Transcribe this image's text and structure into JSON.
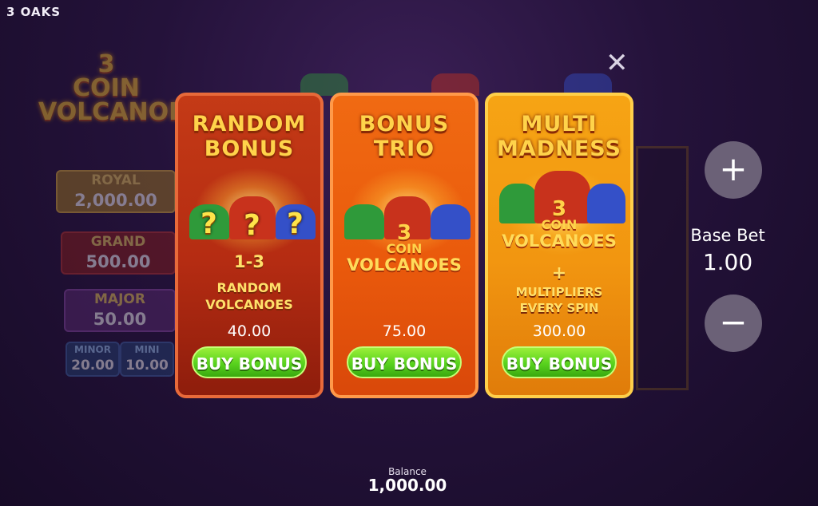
{
  "brand": "3 OAKS",
  "background": {
    "logo": {
      "line1": "3",
      "line2": "COIN",
      "line3": "VOLCANOES"
    },
    "jackpots": {
      "royal": {
        "label": "ROYAL",
        "value": "2,000.00"
      },
      "grand": {
        "label": "GRAND",
        "value": "500.00"
      },
      "major": {
        "label": "MAJOR",
        "value": "50.00"
      },
      "minor": {
        "label": "MINOR",
        "value": "20.00"
      },
      "mini": {
        "label": "MINI",
        "value": "10.00"
      }
    }
  },
  "close_symbol": "✕",
  "cards": [
    {
      "title1": "RANDOM",
      "title2": "BONUS",
      "count": "1-3",
      "desc1": "RANDOM",
      "desc2": "VOLCANOES",
      "price": "40.00",
      "button": "BUY BONUS",
      "question": "?"
    },
    {
      "title1": "BONUS",
      "title2": "TRIO",
      "logo_n": "3",
      "logo_c": "COIN",
      "logo_v": "VOLCANOES",
      "price": "75.00",
      "button": "BUY BONUS"
    },
    {
      "title1": "MULTI",
      "title2": "MADNESS",
      "logo_n": "3",
      "logo_c": "COIN",
      "logo_v": "VOLCANOES",
      "plus": "+",
      "desc1": "MULTIPLIERS",
      "desc2": "EVERY SPIN",
      "price": "300.00",
      "button": "BUY BONUS"
    }
  ],
  "bet": {
    "label": "Base Bet",
    "value": "1.00",
    "plus": "+",
    "minus": "−"
  },
  "balance": {
    "label": "Balance",
    "value": "1,000.00"
  },
  "colors": {
    "volcano_green": "#2f9a3a",
    "volcano_red": "#c8321c",
    "volcano_blue": "#3450c8",
    "button_green": "#58d21e"
  }
}
